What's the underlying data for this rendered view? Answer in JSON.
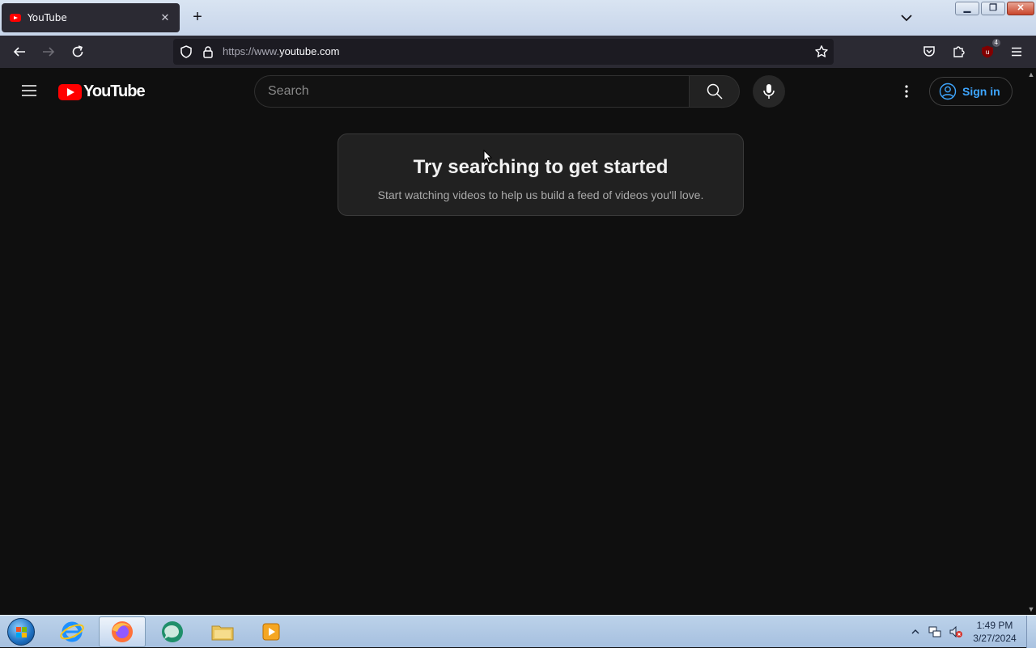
{
  "browser": {
    "tab": {
      "title": "YouTube"
    },
    "url": {
      "dim": "https://www.",
      "host": "youtube.com"
    },
    "extension_badge": "4"
  },
  "youtube": {
    "logo_text": "YouTube",
    "search": {
      "placeholder": "Search"
    },
    "signin_label": "Sign in",
    "card": {
      "title": "Try searching to get started",
      "subtitle": "Start watching videos to help us build a feed of videos you'll love."
    },
    "colors": {
      "background": "#0f0f0f",
      "brand_red": "#ff0000",
      "link_blue": "#3ea6ff"
    }
  },
  "taskbar": {
    "items": [
      "internet-explorer",
      "firefox",
      "media-app",
      "file-explorer",
      "media-player"
    ],
    "time": "1:49 PM",
    "date": "3/27/2024"
  }
}
